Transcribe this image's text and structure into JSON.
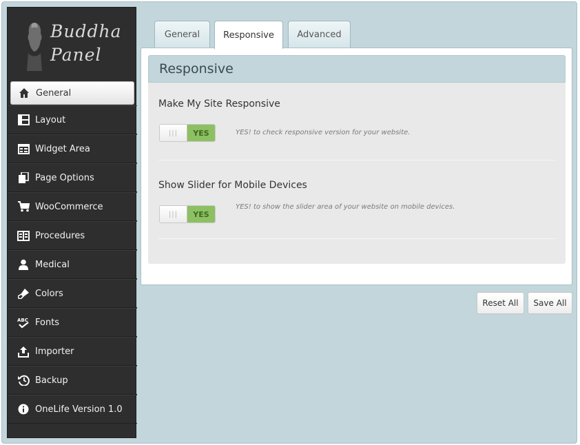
{
  "logo": {
    "line1": "Buddha",
    "line2": "Panel"
  },
  "sidebar": {
    "items": [
      {
        "label": "General",
        "icon": "home-icon"
      },
      {
        "label": "Layout",
        "icon": "layout-icon"
      },
      {
        "label": "Widget Area",
        "icon": "widget-icon"
      },
      {
        "label": "Page Options",
        "icon": "pages-icon"
      },
      {
        "label": "WooCommerce",
        "icon": "cart-icon"
      },
      {
        "label": "Procedures",
        "icon": "procedures-icon"
      },
      {
        "label": "Medical",
        "icon": "user-icon"
      },
      {
        "label": "Colors",
        "icon": "brush-icon"
      },
      {
        "label": "Fonts",
        "icon": "spellcheck-icon"
      },
      {
        "label": "Importer",
        "icon": "upload-icon"
      },
      {
        "label": "Backup",
        "icon": "history-icon"
      },
      {
        "label": "OneLife Version 1.0",
        "icon": "info-icon"
      }
    ],
    "active": "General"
  },
  "tabs": [
    {
      "label": "General"
    },
    {
      "label": "Responsive"
    },
    {
      "label": "Advanced"
    }
  ],
  "active_tab": "Responsive",
  "panel": {
    "title": "Responsive",
    "options": [
      {
        "title": "Make My Site Responsive",
        "toggle_label": "YES",
        "toggle_on": true,
        "description": "YES! to check responsive version for your website."
      },
      {
        "title": "Show Slider for Mobile Devices",
        "toggle_label": "YES",
        "toggle_on": true,
        "description": "YES! to show the slider area of your website on mobile devices."
      }
    ]
  },
  "buttons": {
    "reset_label": "Reset All",
    "save_label": "Save All"
  },
  "colors": {
    "frame": "#c2d6dc",
    "sidebar": "#2e2e2e",
    "toggle_on": "#8cc063"
  }
}
